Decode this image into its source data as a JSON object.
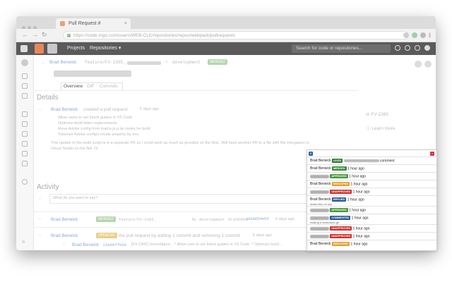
{
  "browser": {
    "tab_title": "Pull Request #",
    "address": "https://code.mgo.com/users/WEB-CLE/repositories/repos/webpack/pullrequests"
  },
  "app": {
    "nav_projects": "Projects",
    "nav_repositories": "Repositories ▾",
    "search_placeholder": "Search for code or repositories..."
  },
  "pr": {
    "author": "Brad Berwick",
    "source_branch": "feature/FV-2365_",
    "target_branch": "development",
    "state": "MERGED",
    "tabs": [
      "Overview",
      "Diff",
      "Commits"
    ],
    "details_heading": "Details",
    "created_line": "created a pull request",
    "created_ago": "5 days ago",
    "bullets": [
      "Allow users to set Intent guides in VS Code",
      "Optimize build listen replacements",
      "Move Adobe config from  load.e.js  p.lar.nodes  for build",
      "Tokenize Adobe config's  locale  property by env."
    ],
    "note": "This update to the build script is in a separate PR so I could work as much as possible on the Mac. Will have another PR to a file with the intregation in Visual Studio on the NA, IS.",
    "activity_heading": "Activity",
    "comment_placeholder": "What do you want to say?",
    "activity_merged_to": "to",
    "activity_in_commit": "in commit",
    "activity_commit_hash": "eGdaf14e54",
    "activity_ago": "5 days ago",
    "updated_badge": "UPDATED",
    "updated_text": "the pull request by adding 1 commit and removing 1 commit",
    "updated_ago": "5 days ago",
    "commit1_hash": "c5e6bffb50",
    "commit1_msg": "[FV-2365] Unconfigure... * Allow user to set Intent guides in VS Code. * Optimize build...",
    "commit2_hash": "bbfbb6a1c8",
    "commit2_msg": "[FV-2365] Unconfigure... * Allow user to set Intent guides in VS Code. * Optimize build...",
    "side_issue": "FV-2365",
    "side_learn": "Learn more"
  },
  "popup": {
    "logo": "B",
    "close": "×",
    "rows": [
      {
        "name": "Brad Berwick",
        "badge": "LIKED",
        "color": "#2f7d32",
        "text": "comment",
        "ago": "",
        "sub": ""
      },
      {
        "name": "Brad Berwick",
        "badge": "MERGED",
        "color": "#3a8a3a",
        "text": "",
        "ago": "1 hour ago",
        "sub": ""
      },
      {
        "name": "",
        "badge": "APPROVED",
        "color": "#4a9a3d",
        "text": "",
        "ago": "1 hour ago",
        "sub": ""
      },
      {
        "name": "Brad Berwick",
        "badge": "RESCOPED",
        "color": "#e0a030",
        "text": "",
        "ago": "1 hour ago",
        "sub": ""
      },
      {
        "name": "",
        "badge": "UNAPPROVED",
        "color": "#d32f2f",
        "text": "",
        "ago": "1 hour ago",
        "sub": ""
      },
      {
        "name": "Brad Berwick",
        "badge": "REPLIED",
        "color": "#2a5a9b",
        "text": "",
        "ago": "1 hour ago",
        "sub": "shake-fies on sky"
      },
      {
        "name": "",
        "badge": "APPROVED",
        "color": "#4a9a3d",
        "text": "",
        "ago": "1 hour ago",
        "sub": ""
      },
      {
        "name": "",
        "badge": "COMMENTED",
        "color": "#2a5a9b",
        "text": "",
        "ago": "1 hour ago",
        "sub": "making a ammoisan ge"
      },
      {
        "name": "",
        "badge": "UNAPPROVED",
        "color": "#d32f2f",
        "text": "",
        "ago": "1 hour ago",
        "sub": ""
      },
      {
        "name": "",
        "badge": "UNAPPROVED",
        "color": "#d32f2f",
        "text": "",
        "ago": "1 hour ago",
        "sub": ""
      },
      {
        "name": "Brad Berwick",
        "badge": "RESCOPED",
        "color": "#e0a030",
        "text": "",
        "ago": "1 hour ago",
        "sub": ""
      }
    ]
  }
}
